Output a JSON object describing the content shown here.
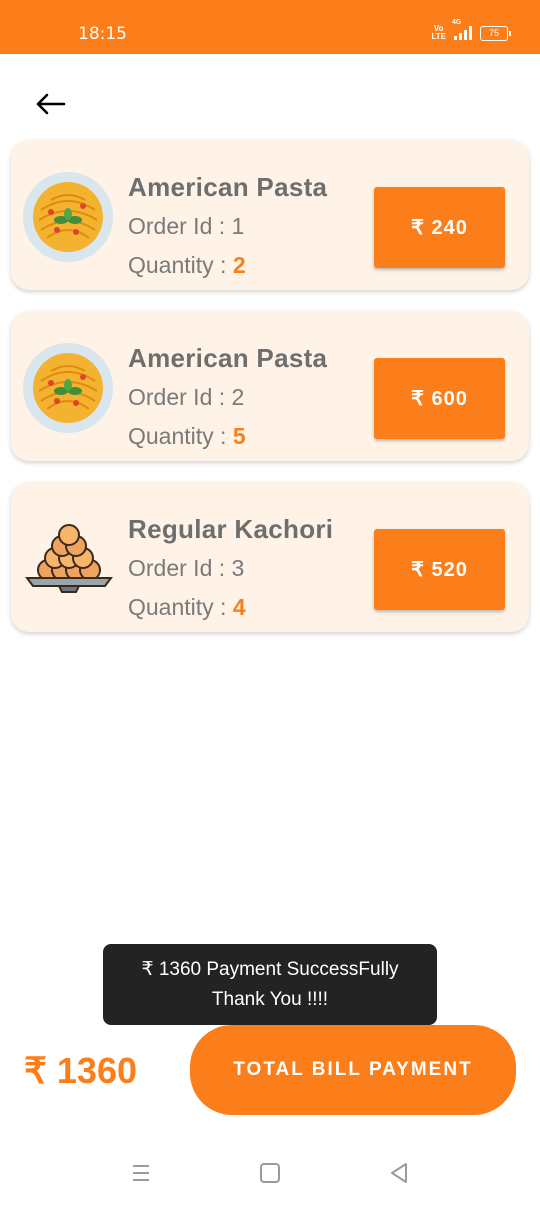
{
  "status_bar": {
    "time": "18:15",
    "volte": [
      "Vo",
      "LTE"
    ],
    "network": "4G",
    "battery": "75"
  },
  "orders": [
    {
      "name": "American Pasta",
      "order_id_label": "Order Id : 1",
      "quantity_label": "Quantity :",
      "quantity": "2",
      "price": "₹ 240",
      "image_icon": "pasta-plate-icon"
    },
    {
      "name": "American Pasta",
      "order_id_label": "Order Id : 2",
      "quantity_label": "Quantity :",
      "quantity": "5",
      "price": "₹ 600",
      "image_icon": "pasta-plate-icon"
    },
    {
      "name": "Regular Kachori",
      "order_id_label": "Order Id : 3",
      "quantity_label": "Quantity :",
      "quantity": "4",
      "price": "₹ 520",
      "image_icon": "kachori-plate-icon"
    }
  ],
  "toast": {
    "line1": "₹ 1360 Payment SuccessFully",
    "line2": "Thank You !!!!"
  },
  "footer": {
    "total": "₹ 1360",
    "pay_button": "TOTAL BILL PAYMENT"
  },
  "colors": {
    "accent": "#fb7e1a",
    "card_bg": "#fef3e6",
    "toast_bg": "#232323"
  }
}
